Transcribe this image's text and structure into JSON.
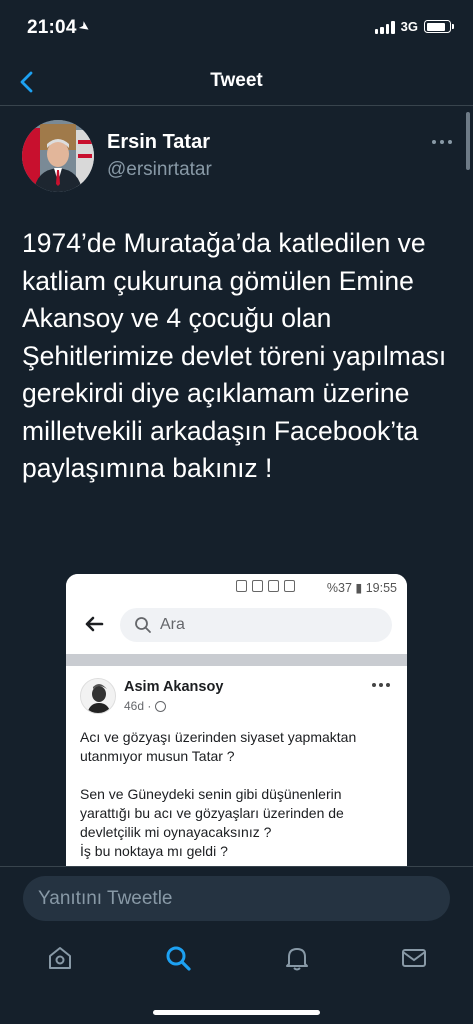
{
  "status": {
    "time": "21:04",
    "network": "3G"
  },
  "nav": {
    "title": "Tweet",
    "back_icon": "chevron-left-icon"
  },
  "author": {
    "name": "Ersin Tatar",
    "handle": "@ersinrtatar"
  },
  "tweet": {
    "text": "1974’de Muratağa’da katledilen ve katliam çukuruna gömülen Emine Akansoy ve 4 çocuğu olan Şehitlerimize devlet töreni yapılması gerekirdi diye açıklamam üzerine milletvekili arkadaşın Facebook’ta paylaşımına bakınız !"
  },
  "media": {
    "phone_status": "%37 ▮ 19:55",
    "search_placeholder": "Ara",
    "post": {
      "author": "Asim Akansoy",
      "age": "46d ·",
      "text": "Acı ve gözyaşı üzerinden siyaset yapmaktan utanmıyor musun Tatar ?\n\nSen ve Güneydeki senin gibi düşünenlerin yarattığı bu acı ve gözyaşları üzerinden de devletçilik mi oynayacaksınız ?\nİş bu noktaya mı geldi ?"
    }
  },
  "reply": {
    "placeholder": "Yanıtını Tweetle"
  },
  "tabs": [
    "home-icon",
    "search-icon",
    "notifications-icon",
    "messages-icon"
  ],
  "colors": {
    "background": "#15202b",
    "accent": "#1da1f2",
    "secondary_text": "#8899a6"
  }
}
